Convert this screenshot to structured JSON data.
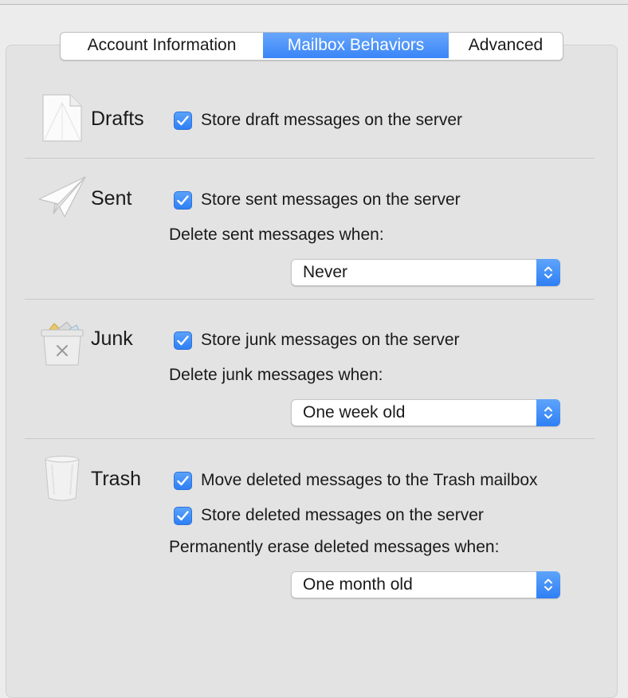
{
  "tabs": [
    {
      "label": "Account Information",
      "active": false
    },
    {
      "label": "Mailbox Behaviors",
      "active": true
    },
    {
      "label": "Advanced",
      "active": false
    }
  ],
  "drafts": {
    "title": "Drafts",
    "icon": "document-icon",
    "store_label": "Store draft messages on the server",
    "store_checked": true
  },
  "sent": {
    "title": "Sent",
    "icon": "paper-plane-icon",
    "store_label": "Store sent messages on the server",
    "store_checked": true,
    "delete_when_label": "Delete sent messages when:",
    "delete_when_value": "Never"
  },
  "junk": {
    "title": "Junk",
    "icon": "junk-bin-icon",
    "store_label": "Store junk messages on the server",
    "store_checked": true,
    "delete_when_label": "Delete junk messages when:",
    "delete_when_value": "One week old"
  },
  "trash": {
    "title": "Trash",
    "icon": "trash-can-icon",
    "move_label": "Move deleted messages to the Trash mailbox",
    "move_checked": true,
    "store_label": "Store deleted messages on the server",
    "store_checked": true,
    "erase_when_label": "Permanently erase deleted messages when:",
    "erase_when_value": "One month old"
  },
  "colors": {
    "accent": "#3a86f7",
    "panel": "#e3e3e3",
    "background": "#ececec"
  }
}
